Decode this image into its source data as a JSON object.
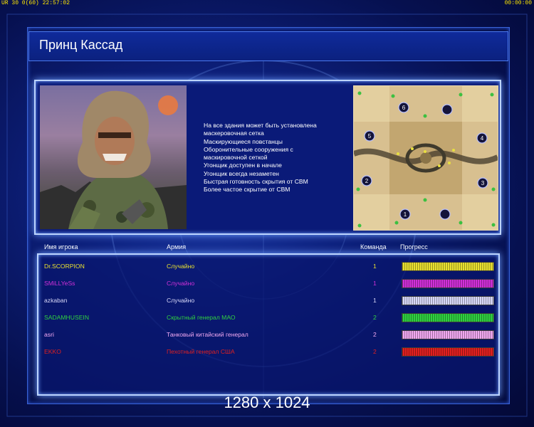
{
  "status_bar": {
    "left": "UR 30 0(60) 22:57:02",
    "right": "00:00:00"
  },
  "general": {
    "name": "Принц Кассад"
  },
  "features": [
    "На все здания может быть установлена",
    " маскеровочная сетка",
    "Маскирующиеся повстанцы",
    "Оборонительные сооружения с",
    " маскировочной сеткой",
    "Угонщик доступен в начале",
    "Угонщик всегда незаметен",
    "Быстрая готовность скрытия от СВМ",
    "Более частое скрытие от СВМ"
  ],
  "columns": {
    "player": "Имя игрока",
    "army": "Армия",
    "team": "Команда",
    "progress": "Прогресс"
  },
  "players": [
    {
      "name": "Dr.SCORPION",
      "army": "Случайно",
      "team": "1",
      "color": "#e8e030",
      "progress": 1.0
    },
    {
      "name": "SMiLLYeSs",
      "army": "Случайно",
      "team": "1",
      "color": "#d030d8",
      "progress": 1.0
    },
    {
      "name": "azkaban",
      "army": "Случайно",
      "team": "1",
      "color": "#d8d8f8",
      "progress": 1.0
    },
    {
      "name": "SADAMHUSEIN",
      "army": "Скрытный генерал МАО",
      "team": "2",
      "color": "#30d040",
      "progress": 1.0
    },
    {
      "name": "asri",
      "army": "Танковый китайский генерал",
      "team": "2",
      "color": "#f0a8f0",
      "progress": 1.0
    },
    {
      "name": "EKKO",
      "army": "Пехотный генерал США",
      "team": "2",
      "color": "#e02020",
      "progress": 1.0
    }
  ],
  "map_start_positions": [
    "1",
    "2",
    "3",
    "4",
    "5",
    "6"
  ],
  "resolution": "1280 x 1024"
}
